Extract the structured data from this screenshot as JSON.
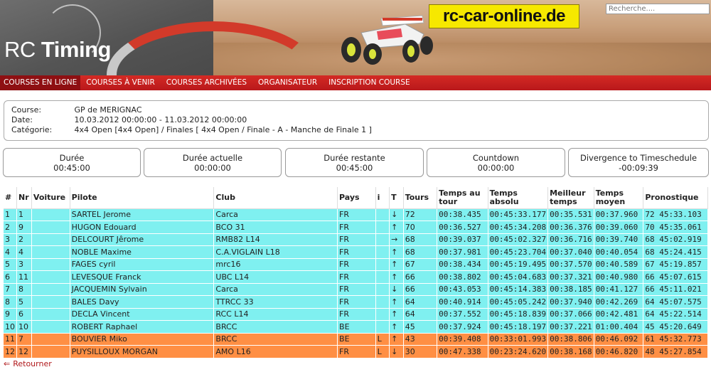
{
  "header": {
    "logo_rc": "RC",
    "logo_timing": "Timing",
    "site_title": "rc-car-online.de",
    "search_placeholder": "Recherche...."
  },
  "nav": [
    {
      "label": "COURSES EN LIGNE",
      "active": true
    },
    {
      "label": "COURSES À VENIR",
      "active": false
    },
    {
      "label": "COURSES ARCHIVÉES",
      "active": false
    },
    {
      "label": "ORGANISATEUR",
      "active": false
    },
    {
      "label": "INSCRIPTION COURSE",
      "active": false
    }
  ],
  "info": {
    "course_label": "Course:",
    "course_value": "GP de MERIGNAC",
    "date_label": "Date:",
    "date_value": "10.03.2012 00:00:00 - 11.03.2012 00:00:00",
    "category_label": "Catégorie:",
    "category_value": "4x4 Open [4x4 Open] / Finales [ 4x4 Open / Finale - A - Manche de Finale 1 ]"
  },
  "timers": [
    {
      "label": "Durée",
      "value": "00:45:00"
    },
    {
      "label": "Durée actuelle",
      "value": "00:00:00"
    },
    {
      "label": "Durée restante",
      "value": "00:45:00"
    },
    {
      "label": "Countdown",
      "value": "00:00:00"
    },
    {
      "label": "Divergence to Timeschedule",
      "value": "-00:09:39"
    }
  ],
  "table": {
    "headers": [
      "#",
      "Nr",
      "Voiture",
      "Pilote",
      "Club",
      "Pays",
      "i",
      "T",
      "Tours",
      "Temps au tour",
      "Temps absolu",
      "Meilleur temps",
      "Temps moyen",
      "Pronostique"
    ],
    "rows": [
      {
        "pos": "1",
        "nr": "1",
        "voiture": "",
        "pilote": "SARTEL Jerome",
        "club": "Carca",
        "pays": "FR",
        "i": "",
        "trend": "down",
        "tours": "72",
        "tour": "00:38.435",
        "absolu": "00:45:33.177",
        "meilleur": "00:35.531",
        "moyen": "00:37.960",
        "prono": "72 45:33.103",
        "color": "cyan"
      },
      {
        "pos": "2",
        "nr": "9",
        "voiture": "",
        "pilote": "HUGON Edouard",
        "club": "BCO 31",
        "pays": "FR",
        "i": "",
        "trend": "up",
        "tours": "70",
        "tour": "00:36.527",
        "absolu": "00:45:34.208",
        "meilleur": "00:36.376",
        "moyen": "00:39.060",
        "prono": "70 45:35.061",
        "color": "cyan"
      },
      {
        "pos": "3",
        "nr": "2",
        "voiture": "",
        "pilote": "DELCOURT Jêrome",
        "club": "RMB82 L14",
        "pays": "FR",
        "i": "",
        "trend": "right",
        "tours": "68",
        "tour": "00:39.037",
        "absolu": "00:45:02.327",
        "meilleur": "00:36.716",
        "moyen": "00:39.740",
        "prono": "68 45:02.919",
        "color": "cyan"
      },
      {
        "pos": "4",
        "nr": "4",
        "voiture": "",
        "pilote": "NOBLE Maxime",
        "club": "C.A.VIGLAIN L18",
        "pays": "FR",
        "i": "",
        "trend": "up",
        "tours": "68",
        "tour": "00:37.981",
        "absolu": "00:45:23.704",
        "meilleur": "00:37.040",
        "moyen": "00:40.054",
        "prono": "68 45:24.415",
        "color": "cyan"
      },
      {
        "pos": "5",
        "nr": "3",
        "voiture": "",
        "pilote": "FAGES cyril",
        "club": "mrc16",
        "pays": "FR",
        "i": "",
        "trend": "up",
        "tours": "67",
        "tour": "00:38.434",
        "absolu": "00:45:19.495",
        "meilleur": "00:37.570",
        "moyen": "00:40.589",
        "prono": "67 45:19.857",
        "color": "cyan"
      },
      {
        "pos": "6",
        "nr": "11",
        "voiture": "",
        "pilote": "LEVESQUE Franck",
        "club": "UBC L14",
        "pays": "FR",
        "i": "",
        "trend": "up",
        "tours": "66",
        "tour": "00:38.802",
        "absolu": "00:45:04.683",
        "meilleur": "00:37.321",
        "moyen": "00:40.980",
        "prono": "66 45:07.615",
        "color": "cyan"
      },
      {
        "pos": "7",
        "nr": "8",
        "voiture": "",
        "pilote": "JACQUEMIN Sylvain",
        "club": "Carca",
        "pays": "FR",
        "i": "",
        "trend": "down",
        "tours": "66",
        "tour": "00:43.053",
        "absolu": "00:45:14.383",
        "meilleur": "00:38.185",
        "moyen": "00:41.127",
        "prono": "66 45:11.021",
        "color": "cyan"
      },
      {
        "pos": "8",
        "nr": "5",
        "voiture": "",
        "pilote": "BALES Davy",
        "club": "TTRCC 33",
        "pays": "FR",
        "i": "",
        "trend": "up",
        "tours": "64",
        "tour": "00:40.914",
        "absolu": "00:45:05.242",
        "meilleur": "00:37.940",
        "moyen": "00:42.269",
        "prono": "64 45:07.575",
        "color": "cyan"
      },
      {
        "pos": "9",
        "nr": "6",
        "voiture": "",
        "pilote": "DECLA Vincent",
        "club": "RCC L14",
        "pays": "FR",
        "i": "",
        "trend": "up",
        "tours": "64",
        "tour": "00:37.552",
        "absolu": "00:45:18.839",
        "meilleur": "00:37.066",
        "moyen": "00:42.481",
        "prono": "64 45:22.514",
        "color": "cyan"
      },
      {
        "pos": "10",
        "nr": "10",
        "voiture": "",
        "pilote": "ROBERT Raphael",
        "club": "BRCC",
        "pays": "BE",
        "i": "",
        "trend": "up",
        "tours": "45",
        "tour": "00:37.924",
        "absolu": "00:45:18.197",
        "meilleur": "00:37.221",
        "moyen": "01:00.404",
        "prono": "45 45:20.649",
        "color": "cyan"
      },
      {
        "pos": "11",
        "nr": "7",
        "voiture": "",
        "pilote": "BOUVIER Miko",
        "club": "BRCC",
        "pays": "BE",
        "i": "L",
        "trend": "up",
        "tours": "43",
        "tour": "00:39.408",
        "absolu": "00:33:01.993",
        "meilleur": "00:38.806",
        "moyen": "00:46.092",
        "prono": "61 45:32.773",
        "color": "orange"
      },
      {
        "pos": "12",
        "nr": "12",
        "voiture": "",
        "pilote": "PUYSILLOUX MORGAN",
        "club": "AMO L16",
        "pays": "FR",
        "i": "L",
        "trend": "down",
        "tours": "30",
        "tour": "00:47.338",
        "absolu": "00:23:24.620",
        "meilleur": "00:38.168",
        "moyen": "00:46.820",
        "prono": "48 45:27.854",
        "color": "orange"
      }
    ]
  },
  "back_label": "Retourner",
  "colors": {
    "nav_red": "#c41e1f",
    "row_cyan": "#7ff0f0",
    "row_orange": "#ff8f44",
    "logo_yellow": "#f6e800"
  }
}
